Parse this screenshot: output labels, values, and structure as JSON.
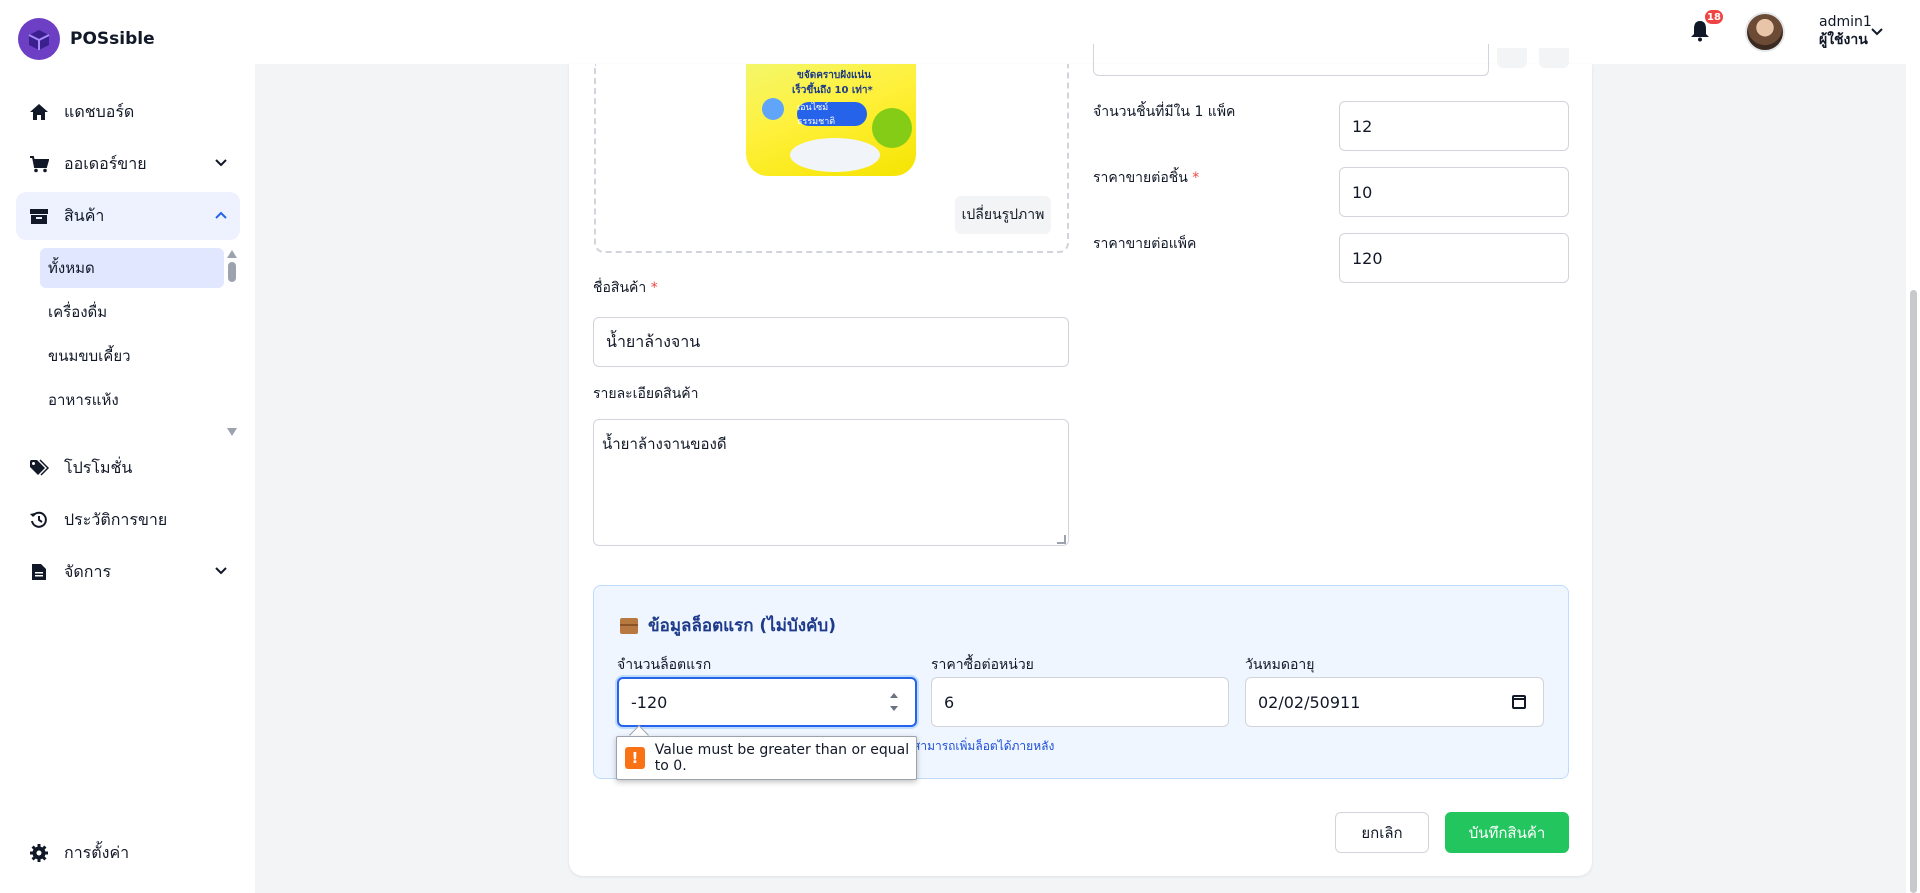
{
  "app": {
    "name": "POSsible"
  },
  "sidebar": {
    "items": [
      {
        "label": "แดชบอร์ด",
        "icon": "home-icon"
      },
      {
        "label": "ออเดอร์ขาย",
        "icon": "cart-icon"
      },
      {
        "label": "สินค้า",
        "icon": "box-icon"
      },
      {
        "label": "โปรโมชั่น",
        "icon": "tag-icon"
      },
      {
        "label": "ประวัติการขาย",
        "icon": "history-icon"
      },
      {
        "label": "จัดการ",
        "icon": "document-icon"
      }
    ],
    "sub_items": [
      "ทั้งหมด",
      "เครื่องดื่ม",
      "ขนมขบเคี้ยว",
      "อาหารแห้ง"
    ],
    "settings": {
      "label": "การตั้งค่า",
      "icon": "gear-icon"
    }
  },
  "header": {
    "notification_count": "18",
    "user_name": "admin1",
    "user_role": "ผู้ใช้งาน"
  },
  "product_image": {
    "change_button": "เปลี่ยนรูปภาพ",
    "pkg_line1": "ขจัดคราบฝังแน่น",
    "pkg_line2": "เร็วขึ้นถึง 10 เท่า*",
    "pkg_pill": "เอนไซม์ ธรรมชาติ"
  },
  "form": {
    "name_label": "ชื่อสินค้า",
    "name_value": "น้ำยาล้างจาน",
    "desc_label": "รายละเอียดสินค้า",
    "desc_value": "น้ำยาล้างจานของดี",
    "pieces_label": "จำนวนชิ้นที่มีใน 1 แพ็ค",
    "pieces_value": "12",
    "unit_price_label": "ราคาขายต่อชิ้น",
    "unit_price_value": "10",
    "pack_price_label": "ราคาขายต่อแพ็ค",
    "pack_price_value": "120",
    "required_mark": "*"
  },
  "lot": {
    "title": "ข้อมูลล็อตแรก (ไม่บังคับ)",
    "qty_label": "จำนวนล็อตแรก",
    "qty_value": "-120",
    "cost_label": "ราคาซื้อต่อหน่วย",
    "cost_value": "6",
    "expiry_label": "วันหมดอายุ",
    "expiry_value": "02/02/50911",
    "hint": "สามารถเพิ่มล็อตได้ภายหลัง",
    "validation_message": "Value must be greater than or equal to 0."
  },
  "actions": {
    "cancel": "ยกเลิก",
    "save": "บันทึกสินค้า"
  },
  "colors": {
    "primary": "#6d3fc4",
    "save": "#22c55e",
    "focus": "#2563eb"
  }
}
